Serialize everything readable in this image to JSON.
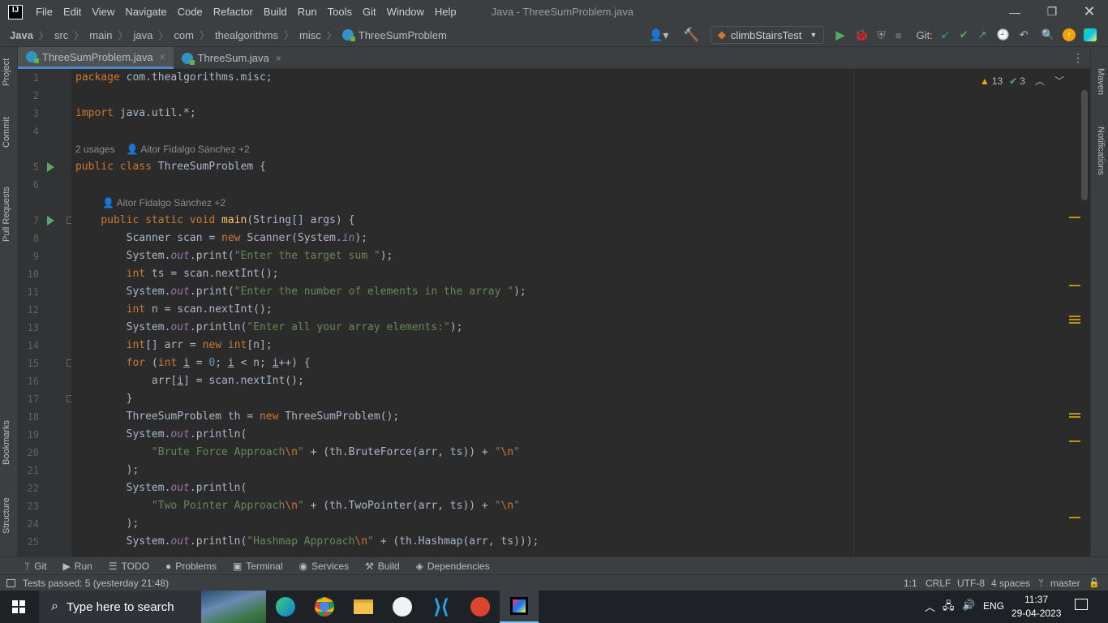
{
  "app": {
    "logo": "IJ",
    "title": "Java - ThreeSumProblem.java"
  },
  "menu": [
    "File",
    "Edit",
    "View",
    "Navigate",
    "Code",
    "Refactor",
    "Build",
    "Run",
    "Tools",
    "Git",
    "Window",
    "Help"
  ],
  "breadcrumb": [
    "Java",
    "src",
    "main",
    "java",
    "com",
    "thealgorithms",
    "misc",
    "ThreeSumProblem"
  ],
  "toolbar": {
    "run_config": "climbStairsTest",
    "git_label": "Git:"
  },
  "left_tools": [
    "Project",
    "Commit",
    "Pull Requests",
    "Bookmarks",
    "Structure"
  ],
  "right_tools": [
    "Maven",
    "Notifications"
  ],
  "tabs": [
    {
      "label": "ThreeSumProblem.java",
      "close": "×",
      "active": true
    },
    {
      "label": "ThreeSum.java",
      "close": "×",
      "active": false
    }
  ],
  "inspections": {
    "warnings": "13",
    "weak": "3"
  },
  "hints": {
    "usages": "2 usages",
    "author": "Aitor Fidalgo Sánchez +2"
  },
  "code": [
    {
      "n": "1",
      "html": "<span class=\"kw\">package</span> com.thealgorithms.misc;"
    },
    {
      "n": "2",
      "html": ""
    },
    {
      "n": "3",
      "html": "<span class=\"kw\">import</span> java.util.*;"
    },
    {
      "n": "4",
      "html": ""
    },
    {
      "n": "5",
      "html": "<span class=\"kw\">public class</span> ThreeSumProblem {"
    },
    {
      "n": "6",
      "html": ""
    },
    {
      "n": "7",
      "html": "    <span class=\"kw\">public static void</span> <span class=\"fn\">main</span>(String[] args) {"
    },
    {
      "n": "8",
      "html": "        Scanner scan = <span class=\"kw\">new</span> Scanner(System.<span class=\"fld\">in</span>);"
    },
    {
      "n": "9",
      "html": "        System.<span class=\"fld\">out</span>.print(<span class=\"str\">\"Enter the target sum \"</span>);"
    },
    {
      "n": "10",
      "html": "        <span class=\"kw\">int</span> ts = scan.nextInt();"
    },
    {
      "n": "11",
      "html": "        System.<span class=\"fld\">out</span>.print(<span class=\"str\">\"Enter the number of elements in the array \"</span>);"
    },
    {
      "n": "12",
      "html": "        <span class=\"kw\">int</span> n = scan.nextInt();"
    },
    {
      "n": "13",
      "html": "        System.<span class=\"fld\">out</span>.println(<span class=\"str\">\"Enter all your array elements:\"</span>);"
    },
    {
      "n": "14",
      "html": "        <span class=\"kw\">int</span>[] arr = <span class=\"kw\">new int</span>[n];"
    },
    {
      "n": "15",
      "html": "        <span class=\"kw\">for</span> (<span class=\"kw\">int</span> <u>i</u> = <span class=\"num\">0</span>; <u>i</u> &lt; n; <u>i</u>++) {"
    },
    {
      "n": "16",
      "html": "            arr[<u>i</u>] = scan.nextInt();"
    },
    {
      "n": "17",
      "html": "        }"
    },
    {
      "n": "18",
      "html": "        ThreeSumProblem th = <span class=\"kw\">new</span> ThreeSumProblem();"
    },
    {
      "n": "19",
      "html": "        System.<span class=\"fld\">out</span>.println("
    },
    {
      "n": "20",
      "html": "            <span class=\"str\">\"Brute Force Approach<span class=\"esc\">\\n</span>\"</span> + (th.BruteForce(arr, ts)) + <span class=\"str\">\"<span class=\"esc\">\\n</span>\"</span>"
    },
    {
      "n": "21",
      "html": "        );"
    },
    {
      "n": "22",
      "html": "        System.<span class=\"fld\">out</span>.println("
    },
    {
      "n": "23",
      "html": "            <span class=\"str\">\"Two Pointer Approach<span class=\"esc\">\\n</span>\"</span> + (th.TwoPointer(arr, ts)) + <span class=\"str\">\"<span class=\"esc\">\\n</span>\"</span>"
    },
    {
      "n": "24",
      "html": "        );"
    },
    {
      "n": "25",
      "html": "        System.<span class=\"fld\">out</span>.println(<span class=\"str\">\"Hashmap Approach<span class=\"esc\">\\n</span>\"</span> + (th.Hashmap(arr, ts)));"
    }
  ],
  "bottom_tools": [
    "Git",
    "Run",
    "TODO",
    "Problems",
    "Terminal",
    "Services",
    "Build",
    "Dependencies"
  ],
  "status": {
    "message": "Tests passed: 5 (yesterday 21:48)",
    "position": "1:1",
    "line_sep": "CRLF",
    "encoding": "UTF-8",
    "indent": "4 spaces",
    "branch": "master"
  },
  "taskbar": {
    "search_placeholder": "Type here to search",
    "lang": "ENG",
    "time": "11:37",
    "date": "29-04-2023"
  },
  "colors": {
    "accent": "#4a88c7",
    "keyword": "#cc7832",
    "string": "#6a8759",
    "run_green": "#59a869",
    "warning": "#be9117"
  }
}
